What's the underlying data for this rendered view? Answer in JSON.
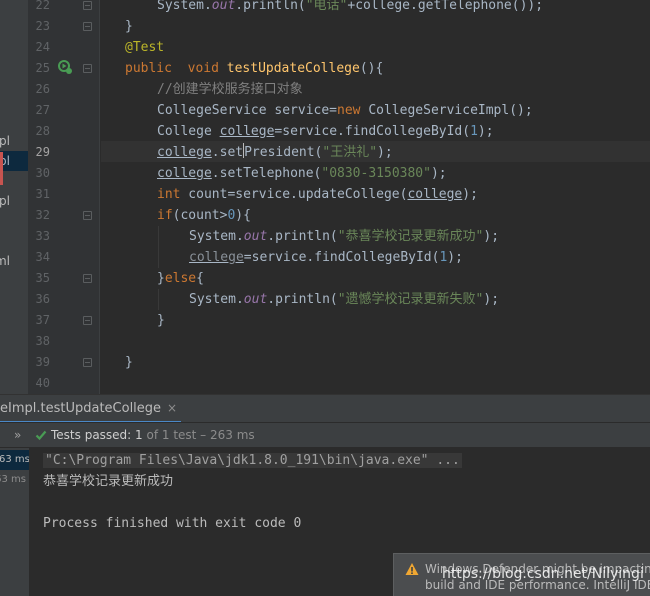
{
  "project_items": [
    "pl",
    "eImpl",
    "pl",
    ".iml"
  ],
  "line_numbers": [
    "22",
    "23",
    "24",
    "25",
    "26",
    "27",
    "28",
    "29",
    "30",
    "31",
    "32",
    "33",
    "34",
    "35",
    "36",
    "37",
    "38",
    "39",
    "40"
  ],
  "code": {
    "l22": {
      "a": "System.",
      "b": "out",
      "c": ".println(",
      "d": "\"电话\"",
      "e": "+college.getTelephone());"
    },
    "l23": {
      "a": "}"
    },
    "l24": {
      "a": "@Test"
    },
    "l25": {
      "a": "public",
      "b": "  void ",
      "c": "testUpdateCollege",
      "d": "(){"
    },
    "l26": {
      "a": "//创建学校服务接口对象"
    },
    "l27": {
      "a": "CollegeService service=",
      "b": "new",
      "c": " CollegeServiceImpl();"
    },
    "l28": {
      "a": "College ",
      "b": "college",
      "c": "=service.findCollegeById(",
      "d": "1",
      "e": ");"
    },
    "l29": {
      "a": "college",
      "b": ".set",
      "c": "President(",
      "d": "\"王洪礼\"",
      "e": ");"
    },
    "l30": {
      "a": "college",
      "b": ".setTelephone(",
      "c": "\"0830-3150380\"",
      "d": ");"
    },
    "l31": {
      "a": "int",
      "b": " count=service.updateCollege(",
      "c": "college",
      "d": ");"
    },
    "l32": {
      "a": "if",
      "b": "(count>",
      "c": "0",
      "d": "){"
    },
    "l33": {
      "a": "System.",
      "b": "out",
      "c": ".println(",
      "d": "\"恭喜学校记录更新成功\"",
      "e": ");"
    },
    "l34": {
      "a": "college",
      "b": "=service.findCollegeById(",
      "c": "1",
      "d": ");"
    },
    "l35": {
      "a": "}",
      "b": "else",
      "c": "{"
    },
    "l36": {
      "a": "System.",
      "b": "out",
      "c": ".println(",
      "d": "\"遗憾学校记录更新失败\"",
      "e": ");"
    },
    "l37": {
      "a": "}"
    },
    "l39": {
      "a": "}"
    }
  },
  "run_panel": {
    "tab_label": "eImpl.testUpdateCollege",
    "close_glyph": "×",
    "chevron": "»",
    "tests_passed_label": "Tests passed: 1",
    "tests_summary": " of 1 test – 263 ms",
    "tree_times": [
      "63 ms",
      "63 ms"
    ],
    "console_lines": [
      "\"C:\\Program Files\\Java\\jdk1.8.0_191\\bin\\java.exe\" ...",
      "恭喜学校记录更新成功",
      "",
      "Process finished with exit code 0"
    ]
  },
  "notification": {
    "line1": "Windows Defender might be impacting",
    "line2": "build and IDE performance. IntelliJ IDE"
  },
  "watermark": "https://blog.csdn.net/Nilyingi",
  "colors": {
    "editor_bg": "#2b2b2b",
    "keyword": "#cc7832",
    "string": "#6a8759",
    "number": "#6897bb",
    "success": "#499c54",
    "warning": "#f0a732"
  }
}
